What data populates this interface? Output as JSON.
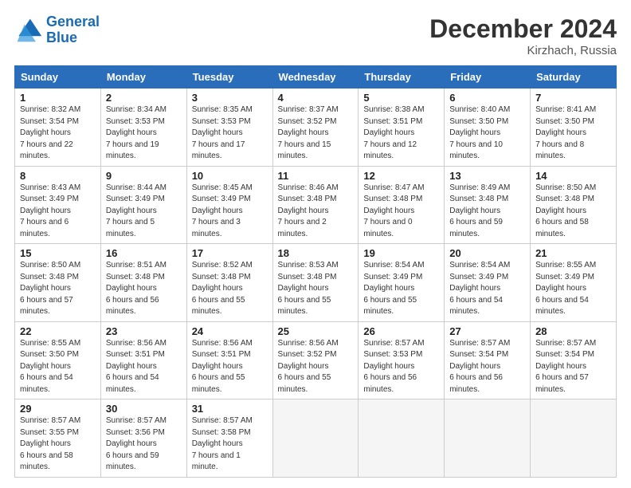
{
  "header": {
    "logo_line1": "General",
    "logo_line2": "Blue",
    "title": "December 2024",
    "subtitle": "Kirzhach, Russia"
  },
  "weekdays": [
    "Sunday",
    "Monday",
    "Tuesday",
    "Wednesday",
    "Thursday",
    "Friday",
    "Saturday"
  ],
  "weeks": [
    [
      {
        "day": "1",
        "sunrise": "8:32 AM",
        "sunset": "3:54 PM",
        "daylight": "7 hours and 22 minutes."
      },
      {
        "day": "2",
        "sunrise": "8:34 AM",
        "sunset": "3:53 PM",
        "daylight": "7 hours and 19 minutes."
      },
      {
        "day": "3",
        "sunrise": "8:35 AM",
        "sunset": "3:53 PM",
        "daylight": "7 hours and 17 minutes."
      },
      {
        "day": "4",
        "sunrise": "8:37 AM",
        "sunset": "3:52 PM",
        "daylight": "7 hours and 15 minutes."
      },
      {
        "day": "5",
        "sunrise": "8:38 AM",
        "sunset": "3:51 PM",
        "daylight": "7 hours and 12 minutes."
      },
      {
        "day": "6",
        "sunrise": "8:40 AM",
        "sunset": "3:50 PM",
        "daylight": "7 hours and 10 minutes."
      },
      {
        "day": "7",
        "sunrise": "8:41 AM",
        "sunset": "3:50 PM",
        "daylight": "7 hours and 8 minutes."
      }
    ],
    [
      {
        "day": "8",
        "sunrise": "8:43 AM",
        "sunset": "3:49 PM",
        "daylight": "7 hours and 6 minutes."
      },
      {
        "day": "9",
        "sunrise": "8:44 AM",
        "sunset": "3:49 PM",
        "daylight": "7 hours and 5 minutes."
      },
      {
        "day": "10",
        "sunrise": "8:45 AM",
        "sunset": "3:49 PM",
        "daylight": "7 hours and 3 minutes."
      },
      {
        "day": "11",
        "sunrise": "8:46 AM",
        "sunset": "3:48 PM",
        "daylight": "7 hours and 2 minutes."
      },
      {
        "day": "12",
        "sunrise": "8:47 AM",
        "sunset": "3:48 PM",
        "daylight": "7 hours and 0 minutes."
      },
      {
        "day": "13",
        "sunrise": "8:49 AM",
        "sunset": "3:48 PM",
        "daylight": "6 hours and 59 minutes."
      },
      {
        "day": "14",
        "sunrise": "8:50 AM",
        "sunset": "3:48 PM",
        "daylight": "6 hours and 58 minutes."
      }
    ],
    [
      {
        "day": "15",
        "sunrise": "8:50 AM",
        "sunset": "3:48 PM",
        "daylight": "6 hours and 57 minutes."
      },
      {
        "day": "16",
        "sunrise": "8:51 AM",
        "sunset": "3:48 PM",
        "daylight": "6 hours and 56 minutes."
      },
      {
        "day": "17",
        "sunrise": "8:52 AM",
        "sunset": "3:48 PM",
        "daylight": "6 hours and 55 minutes."
      },
      {
        "day": "18",
        "sunrise": "8:53 AM",
        "sunset": "3:48 PM",
        "daylight": "6 hours and 55 minutes."
      },
      {
        "day": "19",
        "sunrise": "8:54 AM",
        "sunset": "3:49 PM",
        "daylight": "6 hours and 55 minutes."
      },
      {
        "day": "20",
        "sunrise": "8:54 AM",
        "sunset": "3:49 PM",
        "daylight": "6 hours and 54 minutes."
      },
      {
        "day": "21",
        "sunrise": "8:55 AM",
        "sunset": "3:49 PM",
        "daylight": "6 hours and 54 minutes."
      }
    ],
    [
      {
        "day": "22",
        "sunrise": "8:55 AM",
        "sunset": "3:50 PM",
        "daylight": "6 hours and 54 minutes."
      },
      {
        "day": "23",
        "sunrise": "8:56 AM",
        "sunset": "3:51 PM",
        "daylight": "6 hours and 54 minutes."
      },
      {
        "day": "24",
        "sunrise": "8:56 AM",
        "sunset": "3:51 PM",
        "daylight": "6 hours and 55 minutes."
      },
      {
        "day": "25",
        "sunrise": "8:56 AM",
        "sunset": "3:52 PM",
        "daylight": "6 hours and 55 minutes."
      },
      {
        "day": "26",
        "sunrise": "8:57 AM",
        "sunset": "3:53 PM",
        "daylight": "6 hours and 56 minutes."
      },
      {
        "day": "27",
        "sunrise": "8:57 AM",
        "sunset": "3:54 PM",
        "daylight": "6 hours and 56 minutes."
      },
      {
        "day": "28",
        "sunrise": "8:57 AM",
        "sunset": "3:54 PM",
        "daylight": "6 hours and 57 minutes."
      }
    ],
    [
      {
        "day": "29",
        "sunrise": "8:57 AM",
        "sunset": "3:55 PM",
        "daylight": "6 hours and 58 minutes."
      },
      {
        "day": "30",
        "sunrise": "8:57 AM",
        "sunset": "3:56 PM",
        "daylight": "6 hours and 59 minutes."
      },
      {
        "day": "31",
        "sunrise": "8:57 AM",
        "sunset": "3:58 PM",
        "daylight": "7 hours and 1 minute."
      },
      null,
      null,
      null,
      null
    ]
  ]
}
